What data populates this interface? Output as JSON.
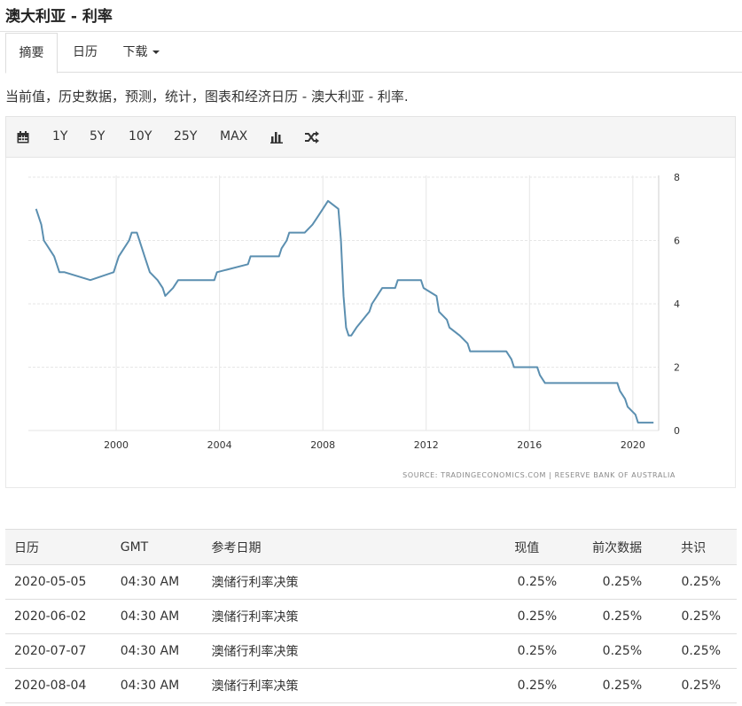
{
  "page": {
    "title": "澳大利亚 - 利率",
    "description": "当前值，历史数据，预测，统计，图表和经济日历 - 澳大利亚 - 利率."
  },
  "tabs": [
    {
      "label": "摘要",
      "active": true
    },
    {
      "label": "日历",
      "active": false
    },
    {
      "label": "下载",
      "active": false,
      "has_caret": true
    }
  ],
  "toolbar": {
    "icons": [
      "calendar-icon",
      "bar-chart-icon",
      "shuffle-icon"
    ],
    "ranges": [
      "1Y",
      "5Y",
      "10Y",
      "25Y",
      "MAX"
    ]
  },
  "chart_data": {
    "type": "line",
    "title": "",
    "xlabel": "",
    "ylabel": "",
    "source": "SOURCE: TRADINGECONOMICS.COM | RESERVE BANK OF AUSTRALIA",
    "x_ticks": [
      "2000",
      "2004",
      "2008",
      "2012",
      "2016",
      "2020"
    ],
    "y_ticks": [
      "0",
      "2",
      "4",
      "6",
      "8"
    ],
    "xlim": [
      1996.6,
      2021.0
    ],
    "ylim": [
      0,
      8
    ],
    "grid": true,
    "y_axis_position": "right",
    "line_color": "#5b8fb0",
    "series": [
      {
        "x": [
          1996.9,
          1997.1,
          1997.2,
          1997.4,
          1997.6,
          1997.8,
          1998.0,
          1999.0,
          1999.9,
          2000.0,
          2000.1,
          2000.3,
          2000.5,
          2000.6,
          2000.8,
          2001.0,
          2001.1,
          2001.3,
          2001.6,
          2001.8,
          2001.9,
          2002.2,
          2002.4,
          2003.8,
          2003.9,
          2005.1,
          2005.2,
          2006.3,
          2006.4,
          2006.6,
          2006.7,
          2007.3,
          2007.6,
          2007.8,
          2008.0,
          2008.2,
          2008.6,
          2008.7,
          2008.8,
          2008.9,
          2009.0,
          2009.1,
          2009.3,
          2009.8,
          2009.9,
          2010.1,
          2010.3,
          2010.8,
          2010.9,
          2011.8,
          2011.9,
          2012.4,
          2012.5,
          2012.8,
          2012.9,
          2013.3,
          2013.6,
          2013.7,
          2015.1,
          2015.3,
          2015.4,
          2016.3,
          2016.4,
          2016.6,
          2019.4,
          2019.5,
          2019.7,
          2019.8,
          2020.1,
          2020.2,
          2020.5,
          2020.8
        ],
        "y": [
          7.0,
          6.5,
          6.0,
          5.75,
          5.5,
          5.0,
          5.0,
          4.75,
          5.0,
          5.25,
          5.5,
          5.75,
          6.0,
          6.25,
          6.25,
          5.75,
          5.5,
          5.0,
          4.75,
          4.5,
          4.25,
          4.5,
          4.75,
          4.75,
          5.0,
          5.25,
          5.5,
          5.5,
          5.75,
          6.0,
          6.25,
          6.25,
          6.5,
          6.75,
          7.0,
          7.25,
          7.0,
          6.0,
          4.25,
          3.25,
          3.0,
          3.0,
          3.25,
          3.75,
          4.0,
          4.25,
          4.5,
          4.5,
          4.75,
          4.75,
          4.5,
          4.25,
          3.75,
          3.5,
          3.25,
          3.0,
          2.75,
          2.5,
          2.5,
          2.25,
          2.0,
          2.0,
          1.75,
          1.5,
          1.5,
          1.25,
          1.0,
          0.75,
          0.5,
          0.25,
          0.25,
          0.25
        ]
      }
    ]
  },
  "calendar_table": {
    "headers": [
      "日历",
      "GMT",
      "参考日期",
      "现值",
      "前次数据",
      "共识"
    ],
    "rows": [
      [
        "2020-05-05",
        "04:30 AM",
        "澳储行利率决策",
        "0.25%",
        "0.25%",
        "0.25%"
      ],
      [
        "2020-06-02",
        "04:30 AM",
        "澳储行利率决策",
        "0.25%",
        "0.25%",
        "0.25%"
      ],
      [
        "2020-07-07",
        "04:30 AM",
        "澳储行利率决策",
        "0.25%",
        "0.25%",
        "0.25%"
      ],
      [
        "2020-08-04",
        "04:30 AM",
        "澳储行利率决策",
        "0.25%",
        "0.25%",
        "0.25%"
      ]
    ]
  }
}
